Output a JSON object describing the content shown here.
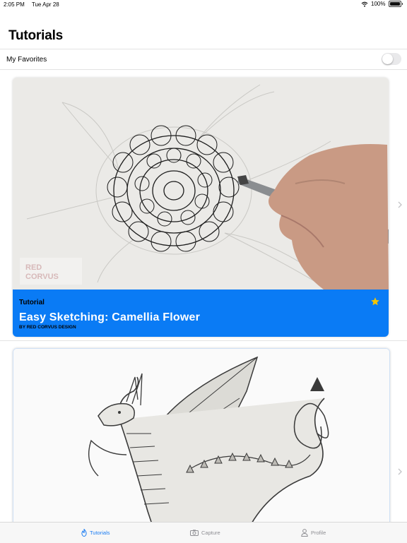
{
  "status_bar": {
    "time": "2:05 PM",
    "date": "Tue Apr 28",
    "battery": "100%",
    "wifi_icon": "wifi-icon",
    "battery_icon": "battery-icon"
  },
  "header": {
    "title": "Tutorials"
  },
  "favorites": {
    "label": "My Favorites",
    "toggle_on": false
  },
  "cards": [
    {
      "type_label": "Tutorial",
      "title": "Easy Sketching: Camellia Flower",
      "author": "BY RED CORVUS DESIGN",
      "favorite_icon": "star-icon",
      "watermark": "RED CORVUS",
      "accent_color": "#0A7BF5",
      "star_color": "#F5C400"
    },
    {
      "image": "dragon-sketch"
    }
  ],
  "tab_bar": {
    "items": [
      {
        "label": "Tutorials",
        "icon": "flame-icon",
        "active": true
      },
      {
        "label": "Capture",
        "icon": "camera-icon",
        "active": false
      },
      {
        "label": "Profile",
        "icon": "person-icon",
        "active": false
      }
    ],
    "active_color": "#1A7CF2",
    "inactive_color": "#8E8E93"
  }
}
